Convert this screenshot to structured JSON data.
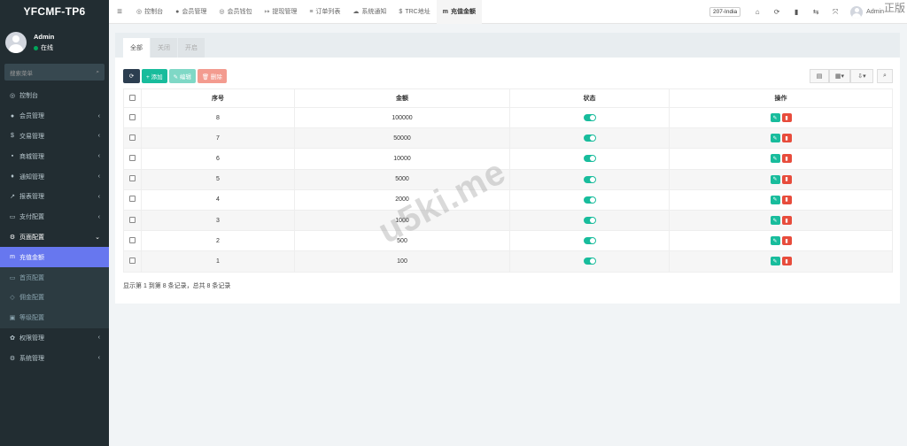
{
  "app": {
    "logo": "YFCMF-TP6"
  },
  "user": {
    "name": "Admin",
    "status": "在线"
  },
  "search": {
    "placeholder": "搜索菜单"
  },
  "sidebar": {
    "items": [
      {
        "label": "控制台",
        "icon": "◎"
      },
      {
        "label": "会员管理",
        "icon": "●"
      },
      {
        "label": "交易管理",
        "icon": "$"
      },
      {
        "label": "商城管理",
        "icon": "▪"
      },
      {
        "label": "通知管理",
        "icon": "♦"
      },
      {
        "label": "报表管理",
        "icon": "↗"
      },
      {
        "label": "支付配置",
        "icon": "▭"
      },
      {
        "label": "页面配置",
        "icon": "⚙"
      },
      {
        "label": "充值金额",
        "icon": "m"
      },
      {
        "label": "首页配置",
        "icon": "▭"
      },
      {
        "label": "佣金配置",
        "icon": "◇"
      },
      {
        "label": "等级配置",
        "icon": "▣"
      },
      {
        "label": "权限管理",
        "icon": "✿"
      },
      {
        "label": "系统管理",
        "icon": "⚙"
      }
    ]
  },
  "topnav": {
    "tabs": [
      {
        "label": "控制台",
        "icon": "◎"
      },
      {
        "label": "会员管理",
        "icon": "●"
      },
      {
        "label": "会员钱包",
        "icon": "◎"
      },
      {
        "label": "提现管理",
        "icon": "↦"
      },
      {
        "label": "订单列表",
        "icon": "≡"
      },
      {
        "label": "系统通知",
        "icon": "☁"
      },
      {
        "label": "TRC地址",
        "icon": "$"
      },
      {
        "label": "充值金额",
        "icon": "m"
      }
    ],
    "region": "207-India",
    "admin": "Admin",
    "corner": "正版"
  },
  "panel": {
    "tabs": [
      "全部",
      "关闭",
      "开启"
    ],
    "buttons": {
      "refresh": "⟳",
      "add": "+ 添加",
      "edit": "✎ 编辑",
      "delete": "🗑 删除"
    },
    "columns": [
      "序号",
      "金额",
      "状态",
      "操作"
    ],
    "rows": [
      {
        "id": "8",
        "amount": "100000"
      },
      {
        "id": "7",
        "amount": "50000"
      },
      {
        "id": "6",
        "amount": "10000"
      },
      {
        "id": "5",
        "amount": "5000"
      },
      {
        "id": "4",
        "amount": "2000"
      },
      {
        "id": "3",
        "amount": "1000"
      },
      {
        "id": "2",
        "amount": "500"
      },
      {
        "id": "1",
        "amount": "100"
      }
    ],
    "pager": "显示第 1 到第 8 条记录，总共 8 条记录"
  },
  "watermark": "u5ki.me"
}
